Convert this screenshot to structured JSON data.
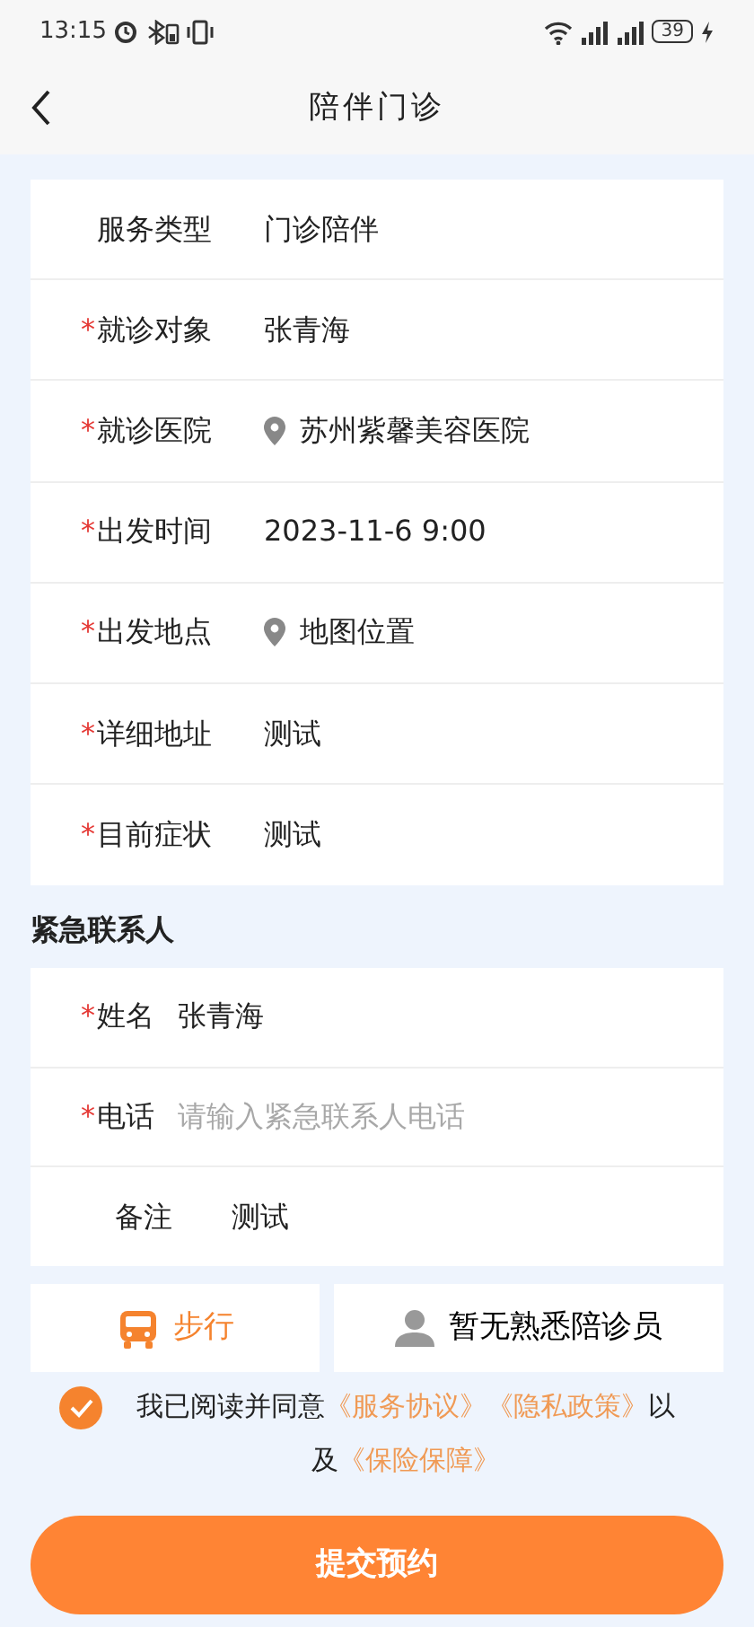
{
  "status_bar": {
    "time": "13:15",
    "battery": "39"
  },
  "header": {
    "title": "陪伴门诊"
  },
  "form": {
    "rows": [
      {
        "label": "服务类型",
        "kind": "text",
        "value": "门诊陪伴"
      },
      {
        "required_mark": "*",
        "label": "就诊对象",
        "kind": "text",
        "value": "张青海"
      },
      {
        "required_mark": "*",
        "label": "就诊医院",
        "kind": "location",
        "value": "苏州紫馨美容医院"
      },
      {
        "required_mark": "*",
        "label": "出发时间",
        "kind": "text",
        "value": "2023-11-6 9:00"
      },
      {
        "required_mark": "*",
        "label": "出发地点",
        "kind": "location",
        "value": "地图位置"
      },
      {
        "required_mark": "*",
        "label": "详细地址",
        "kind": "text",
        "value": "测试"
      },
      {
        "required_mark": "*",
        "label": "目前症状",
        "kind": "text",
        "value": "测试"
      }
    ]
  },
  "emergency": {
    "title": "紧急联系人",
    "rows": [
      {
        "required_mark": "*",
        "label": "姓名",
        "value": "张青海"
      },
      {
        "required_mark": "*",
        "label": "电话",
        "placeholder": "请输入紧急联系人电话"
      },
      {
        "label": "备注",
        "value": "测试"
      }
    ]
  },
  "options": {
    "travel": {
      "label": "步行"
    },
    "companion": {
      "label": "暂无熟悉陪诊员"
    }
  },
  "agreement": {
    "checked": true,
    "parts": [
      {
        "kind": "text",
        "text": "我已阅读并同意"
      },
      {
        "kind": "link",
        "text": "《服务协议》"
      },
      {
        "kind": "link",
        "text": "《隐私政策》"
      },
      {
        "kind": "text",
        "text": "以"
      },
      {
        "kind": "break"
      },
      {
        "kind": "text",
        "text": "及"
      },
      {
        "kind": "link",
        "text": "《保险保障》"
      }
    ]
  },
  "submit": {
    "label": "提交预约"
  }
}
